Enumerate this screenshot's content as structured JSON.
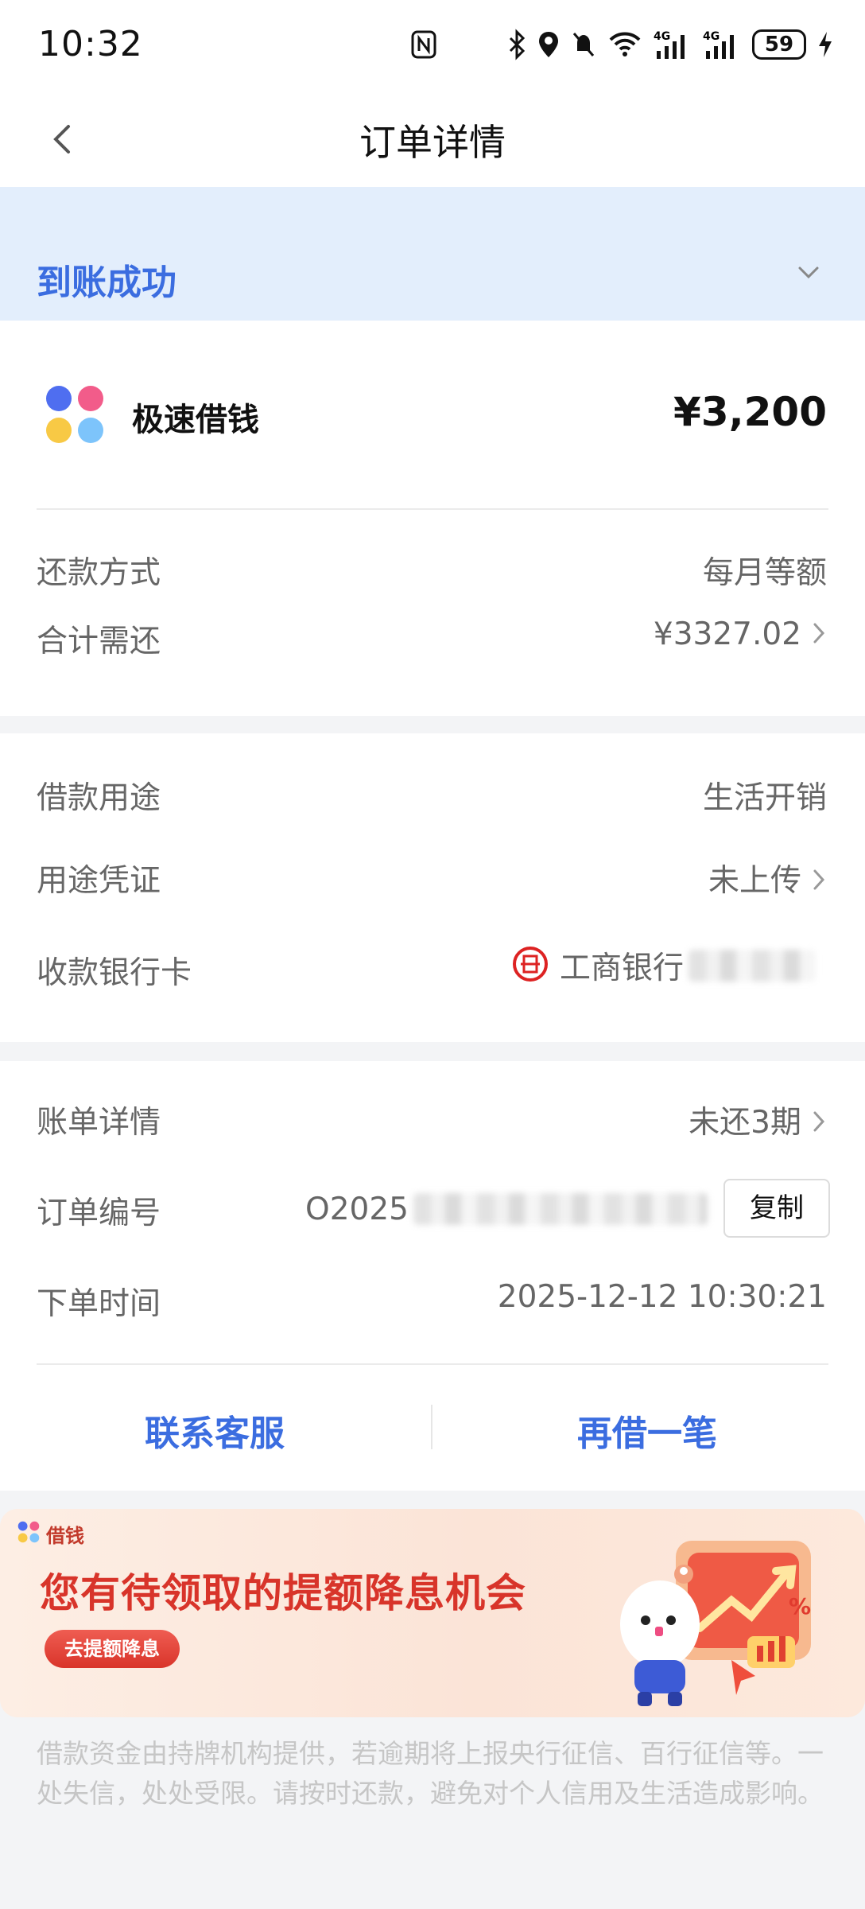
{
  "status_bar": {
    "time": "10:32",
    "battery": "59"
  },
  "nav": {
    "title": "订单详情"
  },
  "status": {
    "text": "到账成功"
  },
  "product": {
    "name": "极速借钱",
    "amount": "¥3,200"
  },
  "repay": {
    "method_label": "还款方式",
    "method_value": "每月等额",
    "total_label": "合计需还",
    "total_value": "¥3327.02"
  },
  "loan": {
    "purpose_label": "借款用途",
    "purpose_value": "生活开销",
    "proof_label": "用途凭证",
    "proof_value": "未上传",
    "card_label": "收款银行卡",
    "card_value": "工商银行"
  },
  "order": {
    "bill_label": "账单详情",
    "bill_value": "未还3期",
    "id_label": "订单编号",
    "id_value_visible": "O2025",
    "copy_label": "复制",
    "time_label": "下单时间",
    "time_value": "2025-12-12 10:30:21"
  },
  "actions": {
    "contact": "联系客服",
    "borrow_again": "再借一笔"
  },
  "promo": {
    "brand": "借钱",
    "title": "您有待领取的提额降息机会",
    "button": "去提额降息"
  },
  "disclaimer": "借款资金由持牌机构提供，若逾期将上报央行征信、百行征信等。一处失信，处处受限。请按时还款，避免对个人信用及生活造成影响。",
  "colors": {
    "accent": "#3b6de0",
    "banner_bg": "#e3eefc",
    "promo_red": "#d8342a"
  }
}
